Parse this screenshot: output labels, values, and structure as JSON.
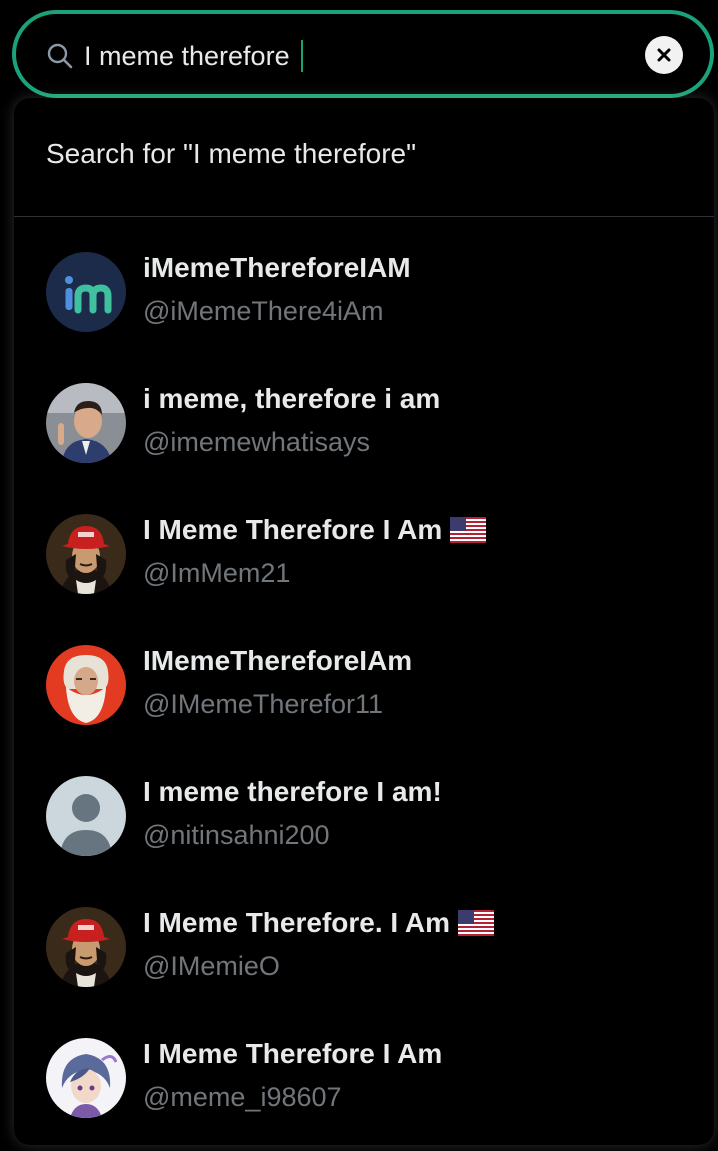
{
  "search": {
    "value": "I meme therefore",
    "suggestion": "Search for \"I meme therefore\""
  },
  "colors": {
    "accent": "#1aa37a",
    "text_primary": "#e7e9ea",
    "text_secondary": "#71767b",
    "background": "#000000"
  },
  "results": [
    {
      "name": "iMemeThereforeIAM",
      "handle": "@iMemeThere4iAm",
      "flag": false,
      "avatar_icon": "im-logo-avatar"
    },
    {
      "name": "i meme, therefore i am",
      "handle": "@imemewhatisays",
      "flag": false,
      "avatar_icon": "man-photo-avatar"
    },
    {
      "name": "I Meme Therefore I Am",
      "handle": "@ImMem21",
      "flag": true,
      "avatar_icon": "descartes-red-hat-avatar"
    },
    {
      "name": "IMemeThereforeIAm",
      "handle": "@IMemeTherefor11",
      "flag": false,
      "avatar_icon": "bearded-man-avatar"
    },
    {
      "name": "I meme therefore I am!",
      "handle": "@nitinsahni200",
      "flag": false,
      "avatar_icon": "default-user-avatar"
    },
    {
      "name": "I Meme Therefore. I Am",
      "handle": "@IMemieO",
      "flag": true,
      "avatar_icon": "descartes-red-hat-avatar"
    },
    {
      "name": "I Meme Therefore I Am",
      "handle": "@meme_i98607",
      "flag": false,
      "avatar_icon": "anime-character-avatar"
    }
  ]
}
